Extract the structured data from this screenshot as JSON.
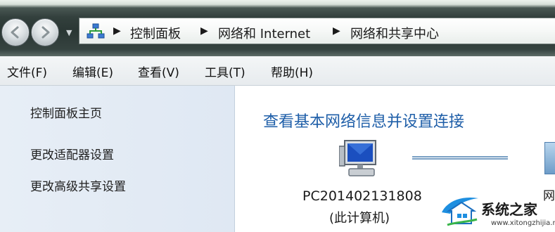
{
  "address_bar": {
    "breadcrumbs": [
      "控制面板",
      "网络和 Internet",
      "网络和共享中心"
    ]
  },
  "menu": {
    "items": [
      "文件(F)",
      "编辑(E)",
      "查看(V)",
      "工具(T)",
      "帮助(H)"
    ]
  },
  "sidebar": {
    "links": [
      "控制面板主页",
      "更改适配器设置",
      "更改高级共享设置"
    ]
  },
  "main": {
    "title": "查看基本网络信息并设置连接",
    "computer_name": "PC201402131808",
    "computer_subtitle": "(此计算机)",
    "network_label_partial": "网"
  },
  "watermark": {
    "text": "系统之家",
    "url": "www.xitongzhijia.net"
  },
  "colors": {
    "title_blue": "#1e5ea8",
    "sidebar_bg": "#e3ebf5"
  }
}
